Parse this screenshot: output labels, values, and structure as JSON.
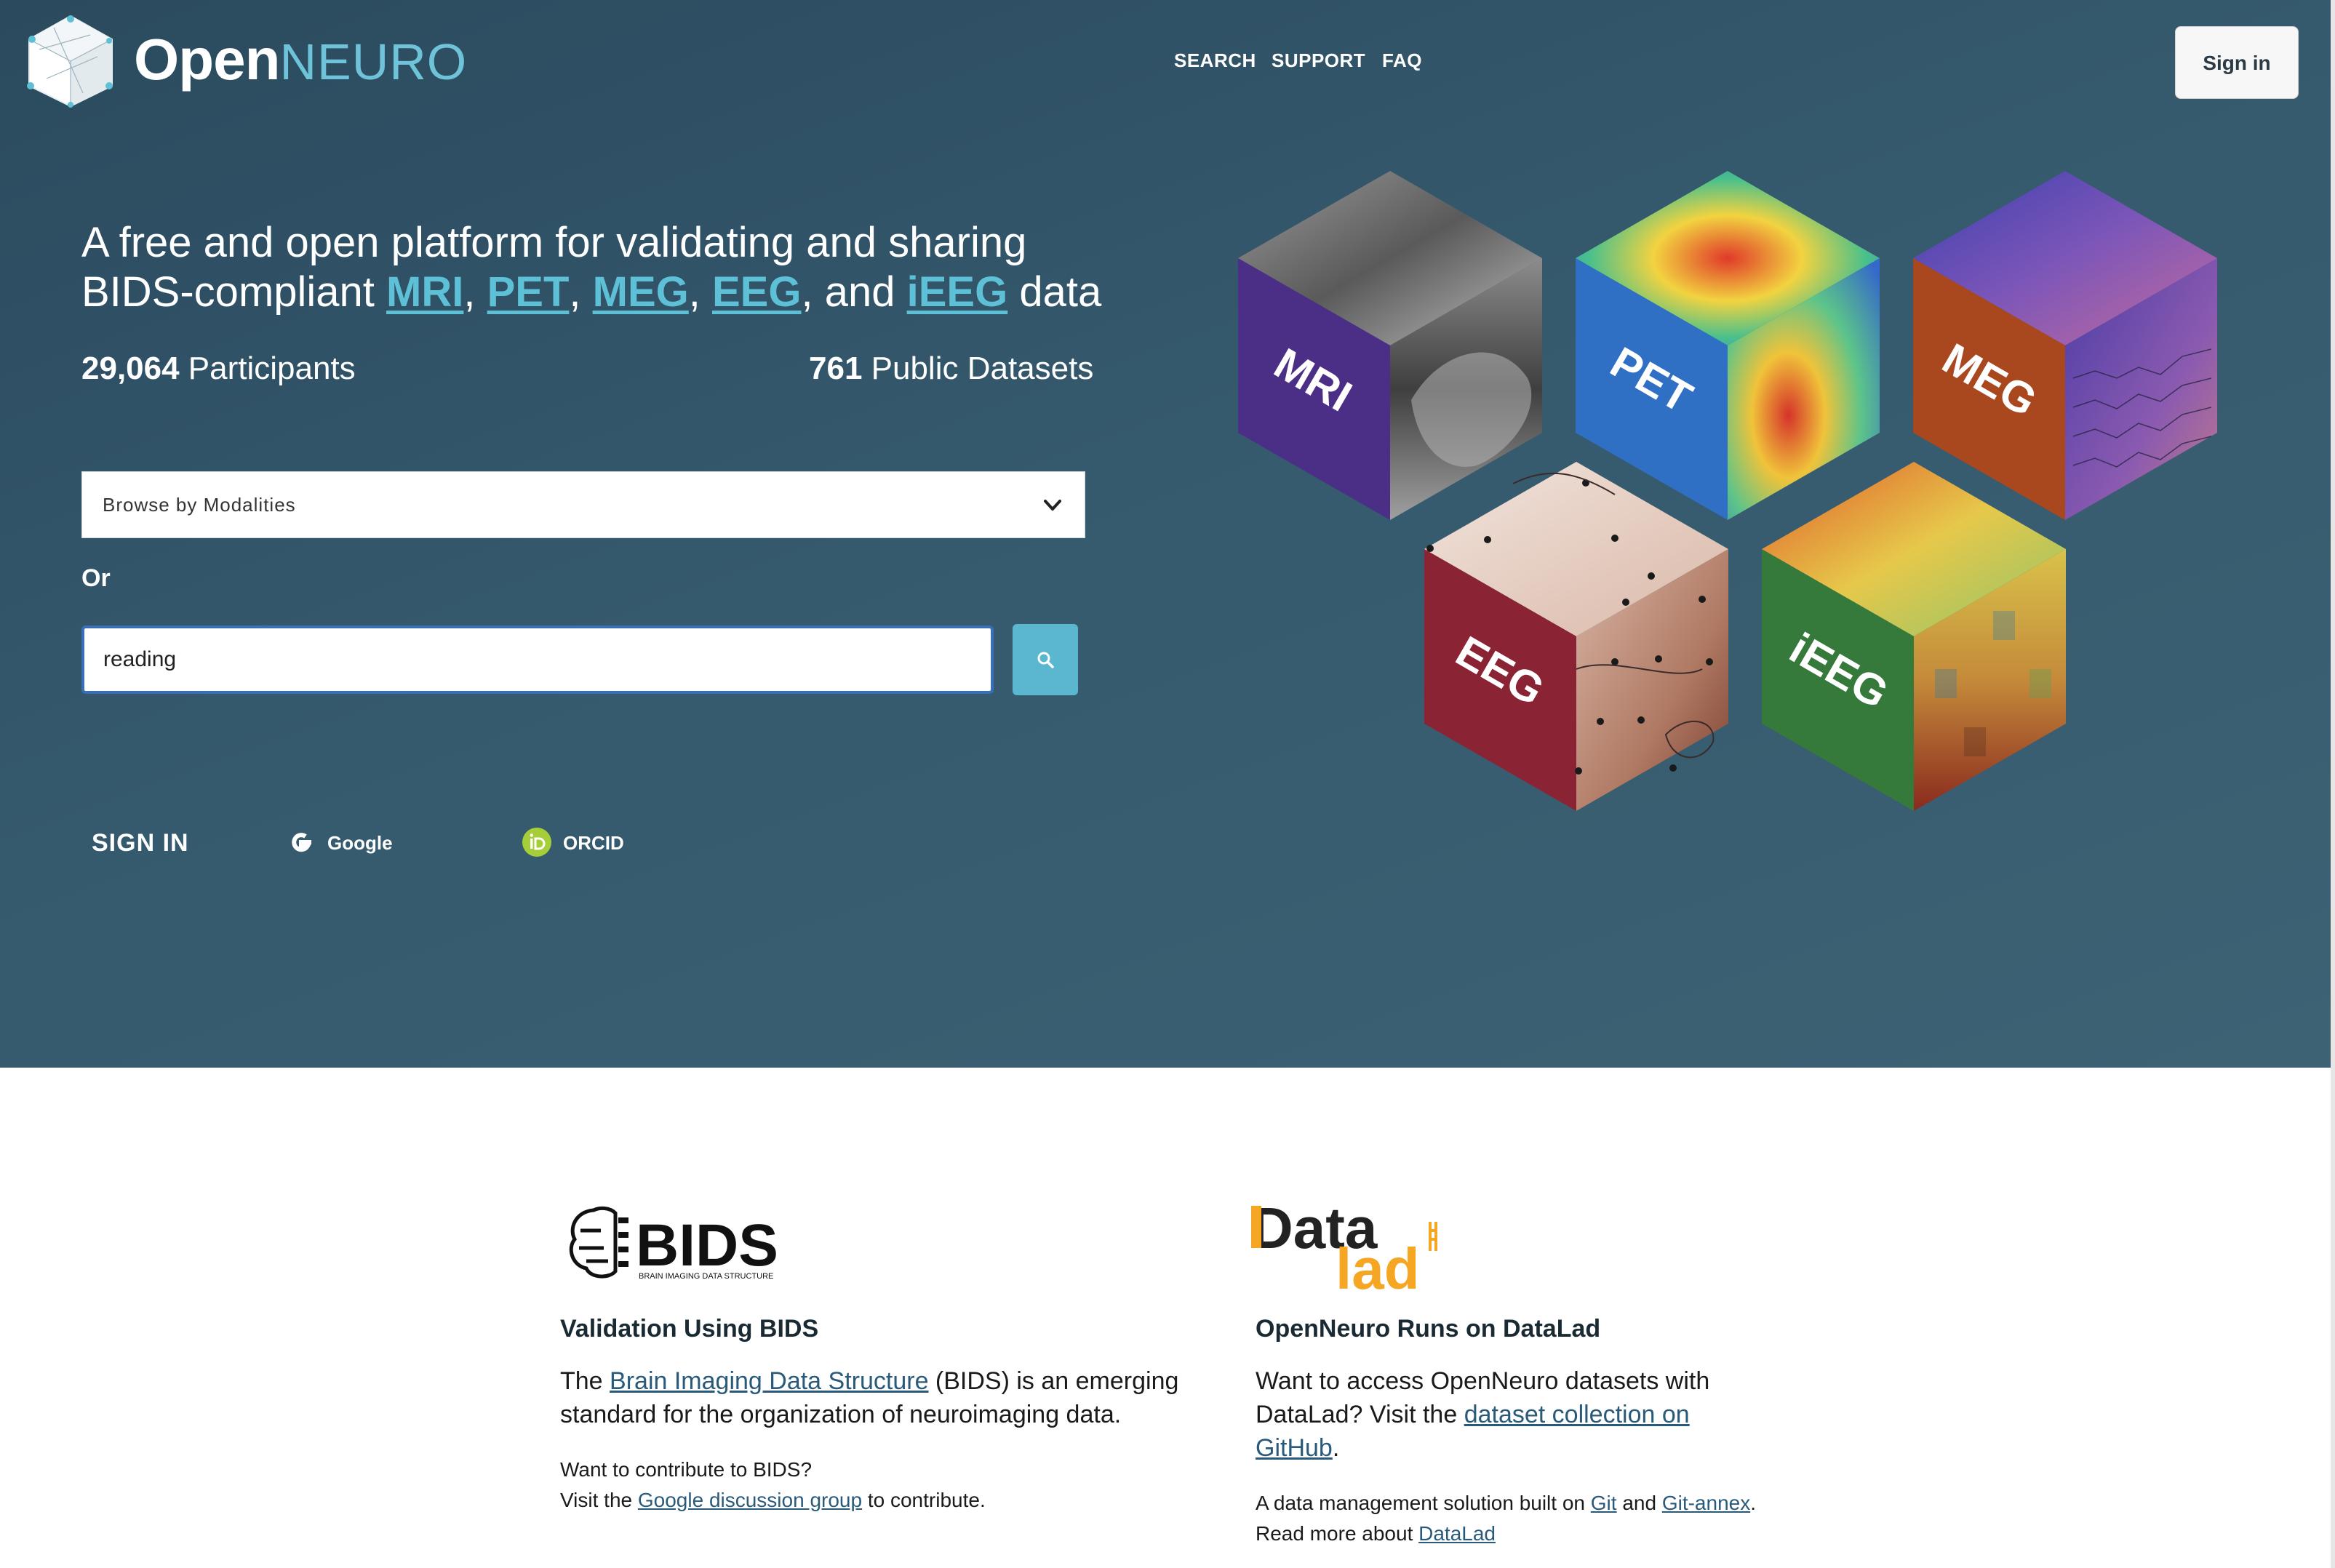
{
  "header": {
    "brand_open": "Open",
    "brand_neuro": "NEURO",
    "nav": {
      "search": "SEARCH",
      "support": "SUPPORT",
      "faq": "FAQ"
    },
    "sign_in_button": "Sign in"
  },
  "hero": {
    "headline_pre": "A free and open platform for validating and sharing BIDS-compliant ",
    "modalities": [
      "MRI",
      "PET",
      "MEG",
      "EEG",
      "iEEG"
    ],
    "sep1": ", ",
    "sep_and": ", and ",
    "headline_post": " data",
    "participants_count": "29,064",
    "participants_label": " Participants",
    "datasets_count": "761",
    "datasets_label": " Public Datasets",
    "modality_select": "Browse by Modalities",
    "or_label": "Or",
    "search": {
      "value": "reading"
    },
    "signin_label": "SIGN IN",
    "providers": {
      "google": "Google",
      "orcid": "ORCID"
    },
    "cubes": {
      "mri": "MRI",
      "pet": "PET",
      "meg": "MEG",
      "eeg": "EEG",
      "ieeg": "iEEG"
    }
  },
  "features": {
    "bids": {
      "logo_text": "BIDS",
      "logo_sub": "BRAIN IMAGING DATA STRUCTURE",
      "title": "Validation Using BIDS",
      "body_pre": "The ",
      "body_link": "Brain Imaging Data Structure",
      "body_post": " (BIDS) is an emerging standard for the organization of neuroimaging data.",
      "small_line1": "Want to contribute to BIDS?",
      "small_pre": "Visit the ",
      "small_link": "Google discussion group",
      "small_post": " to contribute."
    },
    "datalad": {
      "logo_data": "Data",
      "logo_lad": "lad",
      "title": "OpenNeuro Runs on DataLad",
      "body_pre": "Want to access OpenNeuro datasets with DataLad? Visit the ",
      "body_link": "dataset collection on GitHub",
      "body_post": ".",
      "small_pre": "A data management solution built on ",
      "small_git": "Git",
      "small_and": " and ",
      "small_annex": "Git-annex",
      "small_mid": ". Read more about ",
      "small_datalad": "DataLad"
    }
  },
  "colors": {
    "hero_bg": "#35596d",
    "accent": "#5ec0d6",
    "search_button": "#5ab7cf",
    "mri": "#4b2e86",
    "pet": "#2f6fc4",
    "meg": "#a9481f",
    "eeg": "#8a2434",
    "ieeg": "#357a3a"
  }
}
